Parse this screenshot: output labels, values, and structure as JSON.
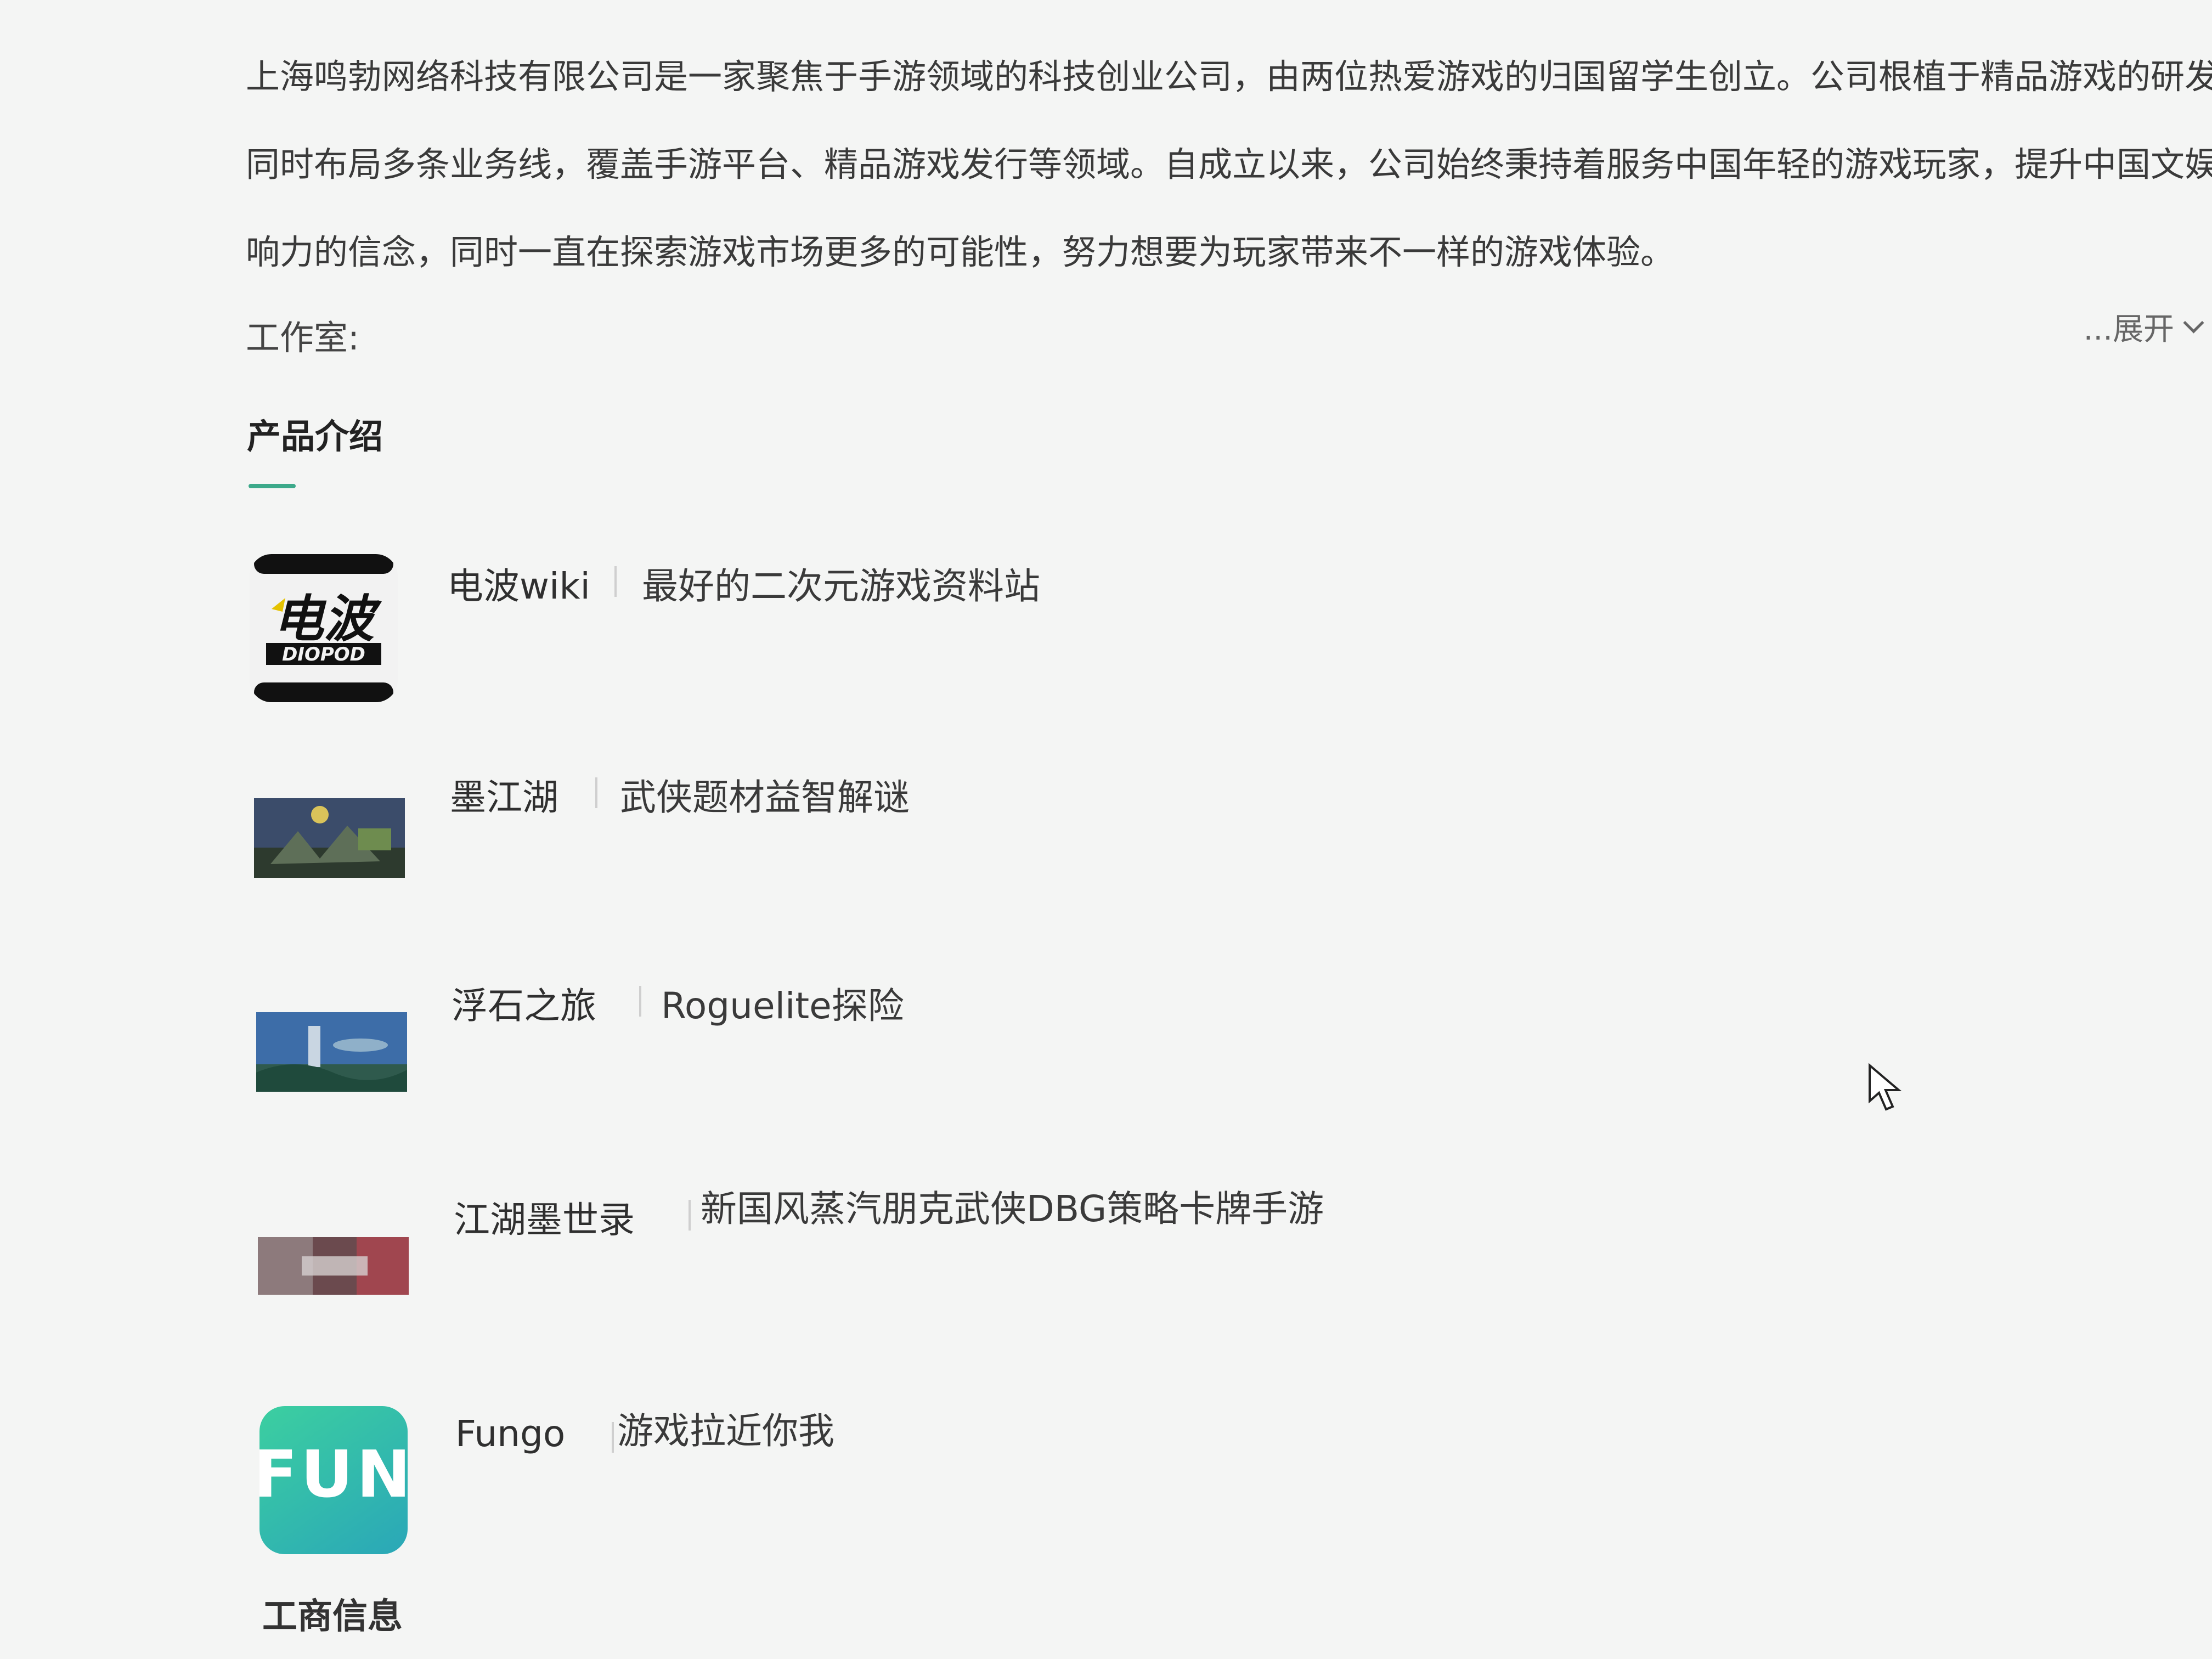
{
  "intro": {
    "line1": "上海鸣勃网络科技有限公司是一家聚焦于手游领域的科技创业公司，由两位热爱游戏的归国留学生创立。公司根植于精品游戏的研发，",
    "line2": "同时布局多条业务线，覆盖手游平台、精品游戏发行等领域。自成立以来，公司始终秉持着服务中国年轻的游戏玩家，提升中国文娱影",
    "line3": "响力的信念，同时一直在探索游戏市场更多的可能性，努力想要为玩家带来不一样的游戏体验。"
  },
  "studio": {
    "label": "工作室:",
    "expand_label": "...展开"
  },
  "products_section": {
    "title": "产品介绍",
    "items": [
      {
        "name": "电波wiki",
        "desc": "最好的二次元游戏资料站",
        "icon": "dianbo-wiki-logo-icon"
      },
      {
        "name": "墨江湖",
        "desc": "武侠题材益智解谜",
        "icon": "mojianghu-thumbnail-icon"
      },
      {
        "name": "浮石之旅",
        "desc": "Roguelite探险",
        "icon": "fushi-thumbnail-icon"
      },
      {
        "name": "江湖墨世录",
        "desc": "新国风蒸汽朋克武侠DBG策略卡牌手游",
        "icon": "jianghu-moshilu-thumbnail-icon"
      },
      {
        "name": "Fungo",
        "desc": "游戏拉近你我",
        "icon": "fungo-logo-icon"
      }
    ]
  },
  "dianbo_logo_text": {
    "top": "电波",
    "bottom": "DIOPOD"
  },
  "fungo_logo_text": "FUN",
  "next_section": {
    "title": "工商信息"
  },
  "colors": {
    "accent": "#3ca98a",
    "background": "#f4f5f4",
    "text": "#333333"
  }
}
